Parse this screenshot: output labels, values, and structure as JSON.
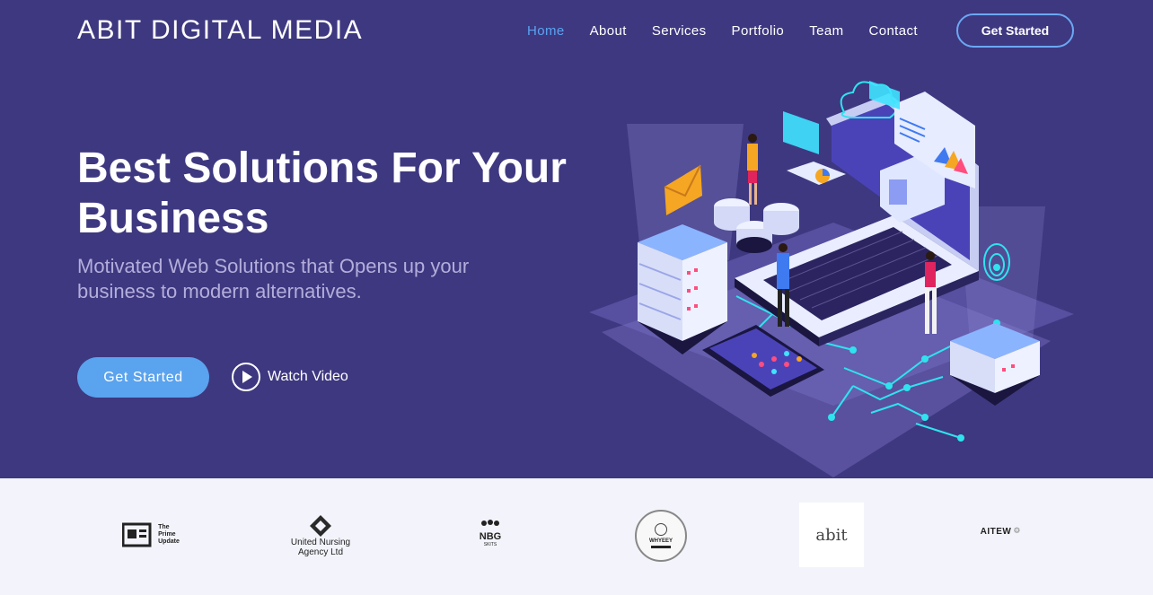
{
  "header": {
    "brand": "ABIT DIGITAL MEDIA",
    "nav": [
      "Home",
      "About",
      "Services",
      "Portfolio",
      "Team",
      "Contact"
    ],
    "active_nav": "Home",
    "cta_label": "Get Started"
  },
  "hero": {
    "title": "Best Solutions For Your Business",
    "subtitle": "Motivated Web Solutions that Opens up your business to modern alternatives.",
    "cta_label": "Get Started",
    "video_label": "Watch Video"
  },
  "clients": {
    "prime": [
      "The",
      "Prime",
      "Update"
    ],
    "united_nursing": [
      "United Nursing",
      "Agency Ltd"
    ],
    "nbg": "NBG",
    "nbg_sub": "SKITS",
    "whyey": "WHYEEY",
    "abit": "abit",
    "aitew": "AITEW"
  },
  "colors": {
    "hero_bg": "#3e3880",
    "accent": "#5aa3ee",
    "nav_active": "#5aa3f0",
    "subtitle": "#b3aedb",
    "clients_bg": "#f3f4fb"
  },
  "icons": [
    "play-icon",
    "cloud-icon",
    "wifi-icon",
    "envelope-icon",
    "laptop-icon",
    "server-icon",
    "phone-icon"
  ]
}
